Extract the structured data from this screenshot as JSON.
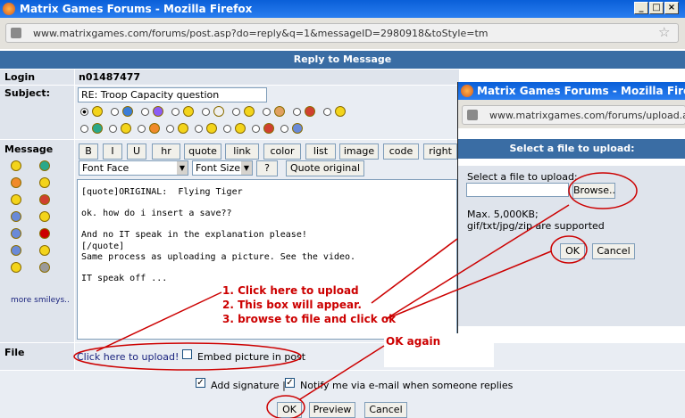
{
  "main_window": {
    "title": "Matrix Games Forums - Mozilla Firefox",
    "url": "www.matrixgames.com/forums/post.asp?do=reply&q=1&messageID=2980918&toStyle=tm"
  },
  "form": {
    "header": "Reply to Message",
    "login_label": "Login",
    "login_value": "n01487477",
    "subject_label": "Subject:",
    "subject_value": "RE: Troop Capacity question",
    "message_label": "Message",
    "more_smileys": "more smileys..",
    "toolbar": {
      "b": "B",
      "i": "I",
      "u": "U",
      "hr": "hr",
      "quote": "quote",
      "link": "link",
      "color": "color",
      "list": "list",
      "image": "image",
      "code": "code",
      "right": "right"
    },
    "font_face": "Font Face",
    "font_size": "Font Size",
    "help": "?",
    "quote_original": "Quote original",
    "message_lines": [
      "[quote]ORIGINAL:  Flying Tiger",
      "",
      "ok. how do i insert a save??",
      "",
      "And no IT speak in the explanation please!",
      "[/quote]",
      "Same process as uploading a picture. See the video.",
      "",
      "IT speak off ..."
    ],
    "file_label": "File",
    "upload_link": "Click here to upload!",
    "embed_label": "Embed picture in post",
    "add_signature": "Add signature |",
    "notify": "Notify me via e-mail when someone replies",
    "ok": "OK",
    "preview": "Preview",
    "cancel": "Cancel"
  },
  "popup": {
    "title": "Matrix Games Forums - Mozilla Firefox",
    "url": "www.matrixgames.com/forums/upload.asp?fil",
    "header": "Select a file to upload:",
    "select_label": "Select a file to upload:",
    "browse": "Browse..",
    "max": "Max. 5,000KB;",
    "types": "gif/txt/jpg/zip are supported",
    "ok": "OK",
    "cancel": "Cancel"
  },
  "annotations": {
    "step1": "1. Click here to upload",
    "step2": "2. This box will appear.",
    "step3": "3. browse to file and click ok",
    "ok_again": "OK again"
  },
  "colors": {
    "annotation": "#cc0000",
    "header_bar": "#3a6da4",
    "label_bg": "#dfe4ec"
  }
}
